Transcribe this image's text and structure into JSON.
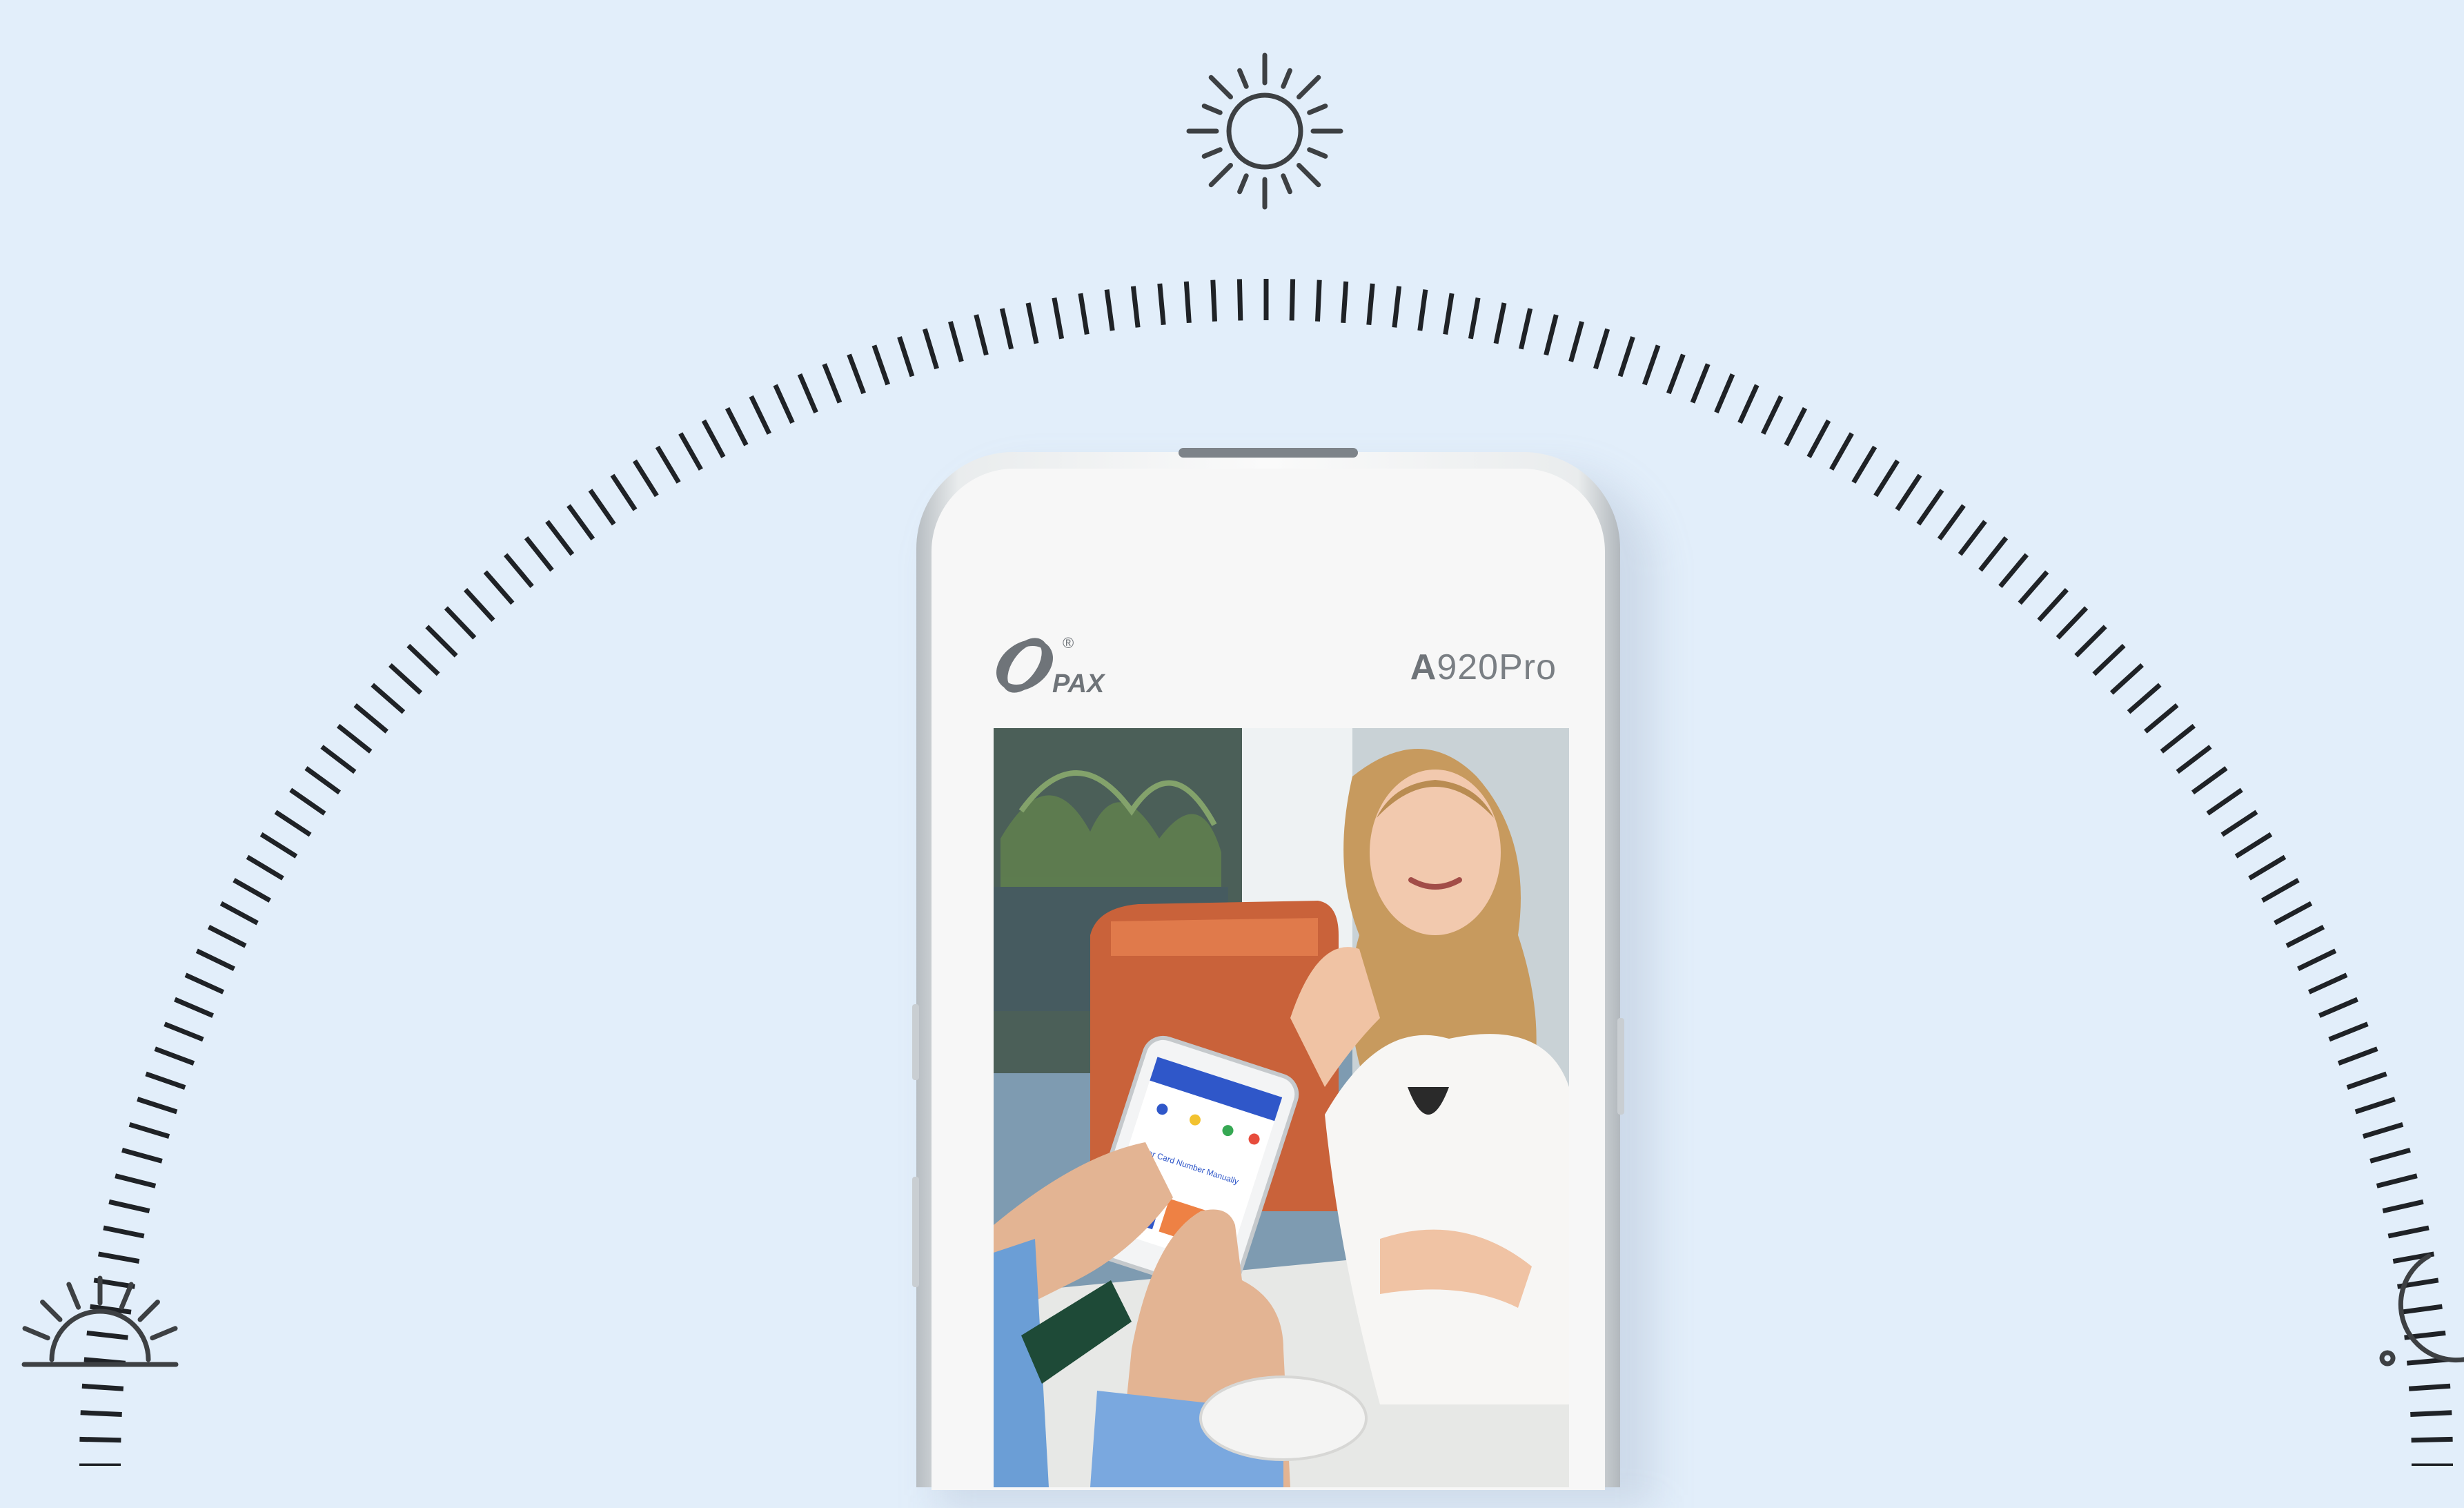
{
  "colors": {
    "background": "#e2eefa",
    "tick": "#1f2226",
    "icon_stroke": "#3d4043",
    "device_body": "#f7f7f7",
    "brand_text": "#6f7479"
  },
  "icons": {
    "top": "sun-icon",
    "left": "sunrise-icon",
    "right": "moon-icon"
  },
  "device": {
    "brand": "PAX",
    "registered_mark": "®",
    "model_prefix": "A",
    "model_suffix": "920Pro"
  },
  "photo": {
    "in_photo_device_text": "Enter Card Number Manually"
  }
}
